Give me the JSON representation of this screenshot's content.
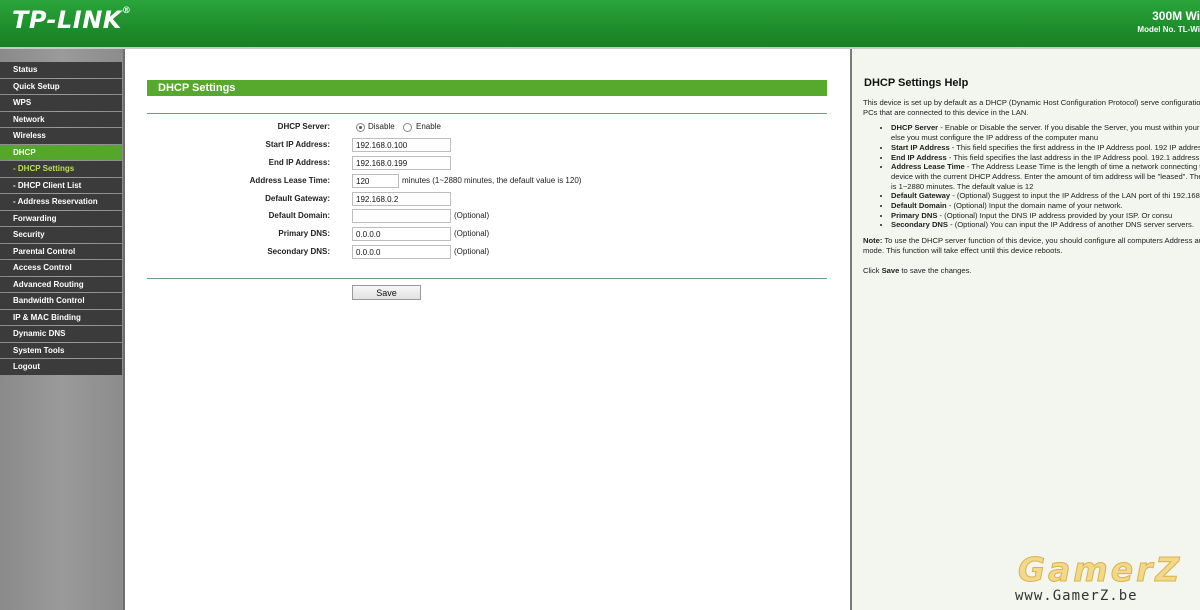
{
  "header": {
    "logo": "TP-LINK",
    "product": "300M Wi",
    "model": "Model No. TL-Wi"
  },
  "sidebar": {
    "items": [
      {
        "label": "Status"
      },
      {
        "label": "Quick Setup"
      },
      {
        "label": "WPS"
      },
      {
        "label": "Network"
      },
      {
        "label": "Wireless"
      },
      {
        "label": "DHCP"
      },
      {
        "label": "- DHCP Settings"
      },
      {
        "label": "- DHCP Client List"
      },
      {
        "label": "- Address Reservation"
      },
      {
        "label": "Forwarding"
      },
      {
        "label": "Security"
      },
      {
        "label": "Parental Control"
      },
      {
        "label": "Access Control"
      },
      {
        "label": "Advanced Routing"
      },
      {
        "label": "Bandwidth Control"
      },
      {
        "label": "IP & MAC Binding"
      },
      {
        "label": "Dynamic DNS"
      },
      {
        "label": "System Tools"
      },
      {
        "label": "Logout"
      }
    ]
  },
  "main": {
    "title": "DHCP Settings",
    "dhcp_server": {
      "label": "DHCP Server:",
      "disable": "Disable",
      "enable": "Enable",
      "selected": "Disable"
    },
    "start_ip": {
      "label": "Start IP Address:",
      "value": "192.168.0.100"
    },
    "end_ip": {
      "label": "End IP Address:",
      "value": "192.168.0.199"
    },
    "lease_time": {
      "label": "Address Lease Time:",
      "value": "120",
      "note": "minutes (1~2880 minutes, the default value is 120)"
    },
    "gateway": {
      "label": "Default Gateway:",
      "value": "192.168.0.2"
    },
    "domain": {
      "label": "Default Domain:",
      "value": "",
      "note": "(Optional)"
    },
    "primary_dns": {
      "label": "Primary DNS:",
      "value": "0.0.0.0",
      "note": "(Optional)"
    },
    "secondary_dns": {
      "label": "Secondary DNS:",
      "value": "0.0.0.0",
      "note": "(Optional)"
    },
    "save_label": "Save"
  },
  "help": {
    "title": "DHCP Settings Help",
    "intro": "This device is set up by default as a DHCP (Dynamic Host Configuration Protocol) serve configuration for all the PCs that are connected to this device in the LAN.",
    "items": [
      {
        "term": "DHCP Server",
        "text": " - Enable or Disable the server. If you disable the Server, you must within your network or else you must configure the IP address of the computer manu"
      },
      {
        "term": "Start IP Address",
        "text": " - This field specifies the first address in the IP Address pool. 192 IP address."
      },
      {
        "term": "End IP Address",
        "text": " - This field specifies the last address in the IP Address pool. 192.1 address."
      },
      {
        "term": "Address Lease Time",
        "text": " - The Address Lease Time is the length of time a network connecting to this device with the current DHCP Address. Enter the amount of tim address will be \"leased\". The time range is 1~2880 minutes. The default value is 12"
      },
      {
        "term": "Default Gateway",
        "text": " - (Optional) Suggest to input the IP Address of the LAN port of thi 192.168.0.1."
      },
      {
        "term": "Default Domain",
        "text": " - (Optional) Input the domain name of your network."
      },
      {
        "term": "Primary DNS",
        "text": " - (Optional) Input the DNS IP address provided by your ISP. Or consu"
      },
      {
        "term": "Secondary DNS",
        "text": " - (Optional) You can input the IP Address of another DNS server servers."
      }
    ],
    "note_term": "Note:",
    "note_text": " To use the DHCP server function of this device, you should configure all computers Address automatically\" mode. This function will take effect until this device reboots.",
    "click_pre": "Click ",
    "click_term": "Save",
    "click_post": " to save the changes."
  },
  "watermark": {
    "brand": "GamerZ",
    "url": "www.GamerZ.be"
  }
}
